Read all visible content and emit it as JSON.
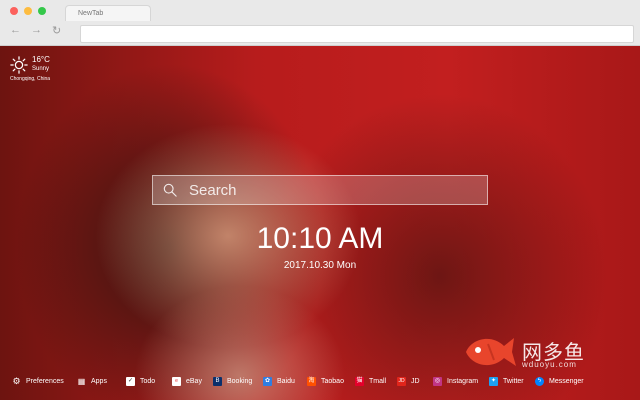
{
  "browser": {
    "tab_title": "NewTab",
    "nav": {
      "back": "←",
      "forward": "→",
      "reload": "↻"
    },
    "address_value": ""
  },
  "weather": {
    "temperature": "16°C",
    "condition": "Sunny",
    "location": "Chongqing,  China",
    "icon": "sun-icon"
  },
  "search": {
    "placeholder": "Search"
  },
  "clock": {
    "time": "10:10 AM",
    "date": "2017.10.30 Mon"
  },
  "watermark": {
    "name": "网多鱼",
    "url": "wduoyu.com"
  },
  "bottom_bar": {
    "items": [
      {
        "label": "Preferences",
        "icon": "gear-icon",
        "color": "#ffffff"
      },
      {
        "label": "Apps",
        "icon": "grid-icon",
        "color": "#ffffff"
      },
      {
        "label": "Todo",
        "icon": "check-icon",
        "color": "#ffffff"
      },
      {
        "label": "eBay",
        "icon": "ebay-icon",
        "color": "#ffffff"
      },
      {
        "label": "Booking",
        "icon": "booking-icon",
        "color": "#0b2f6b"
      },
      {
        "label": "Baidu",
        "icon": "baidu-icon",
        "color": "#2f7de1"
      },
      {
        "label": "Taobao",
        "icon": "taobao-icon",
        "color": "#ff5000"
      },
      {
        "label": "Tmall",
        "icon": "tmall-icon",
        "color": "#e4002b"
      },
      {
        "label": "JD",
        "icon": "jd-icon",
        "color": "#e1251b"
      },
      {
        "label": "Instagram",
        "icon": "instagram-icon",
        "color": "#c13584"
      },
      {
        "label": "Twitter",
        "icon": "twitter-icon",
        "color": "#1da1f2"
      },
      {
        "label": "Messenger",
        "icon": "messenger-icon",
        "color": "#0084ff"
      }
    ]
  }
}
